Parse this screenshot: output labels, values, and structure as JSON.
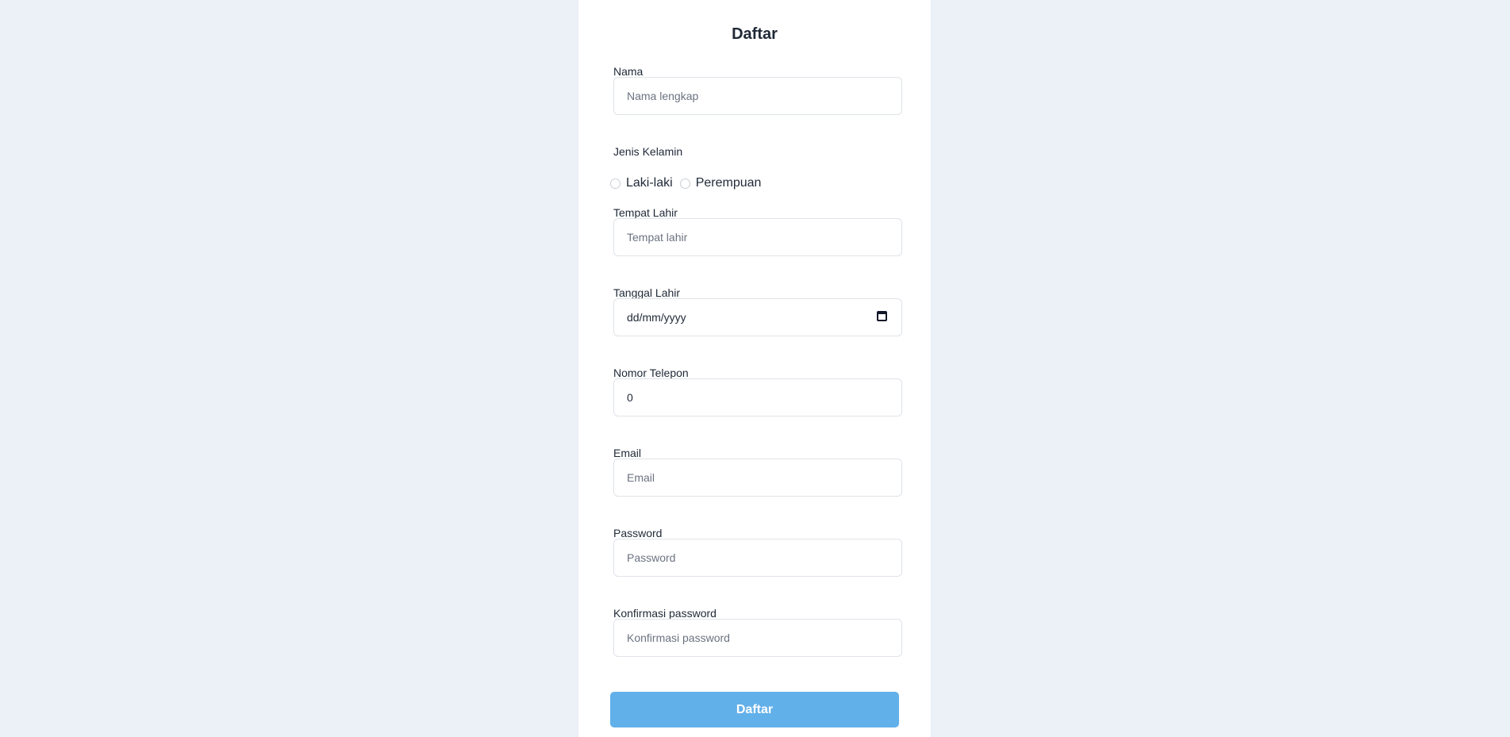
{
  "page": {
    "colors": {
      "background": "#ebf1f6",
      "card": "#ffffff",
      "primary_button": "#62b0ea",
      "input_border": "#dfe3e8"
    }
  },
  "form": {
    "title": "Daftar",
    "name": {
      "label": "Nama",
      "placeholder": "Nama lengkap",
      "value": ""
    },
    "gender": {
      "label": "Jenis Kelamin",
      "options": [
        "Laki-laki",
        "Perempuan"
      ],
      "selected": ""
    },
    "birth_place": {
      "label": "Tempat Lahir",
      "placeholder": "Tempat lahir",
      "value": ""
    },
    "birth_date": {
      "label": "Tanggal Lahir",
      "display": "dd/mm/yyyy",
      "icon": "calendar-icon"
    },
    "phone": {
      "label": "Nomor Telepon",
      "value": "0"
    },
    "email": {
      "label": "Email",
      "placeholder": "Email",
      "value": ""
    },
    "password": {
      "label": "Password",
      "placeholder": "Password",
      "value": ""
    },
    "confirm_password": {
      "label": "Konfirmasi password",
      "placeholder": "Konfirmasi password",
      "value": ""
    },
    "submit_label": "Daftar"
  }
}
